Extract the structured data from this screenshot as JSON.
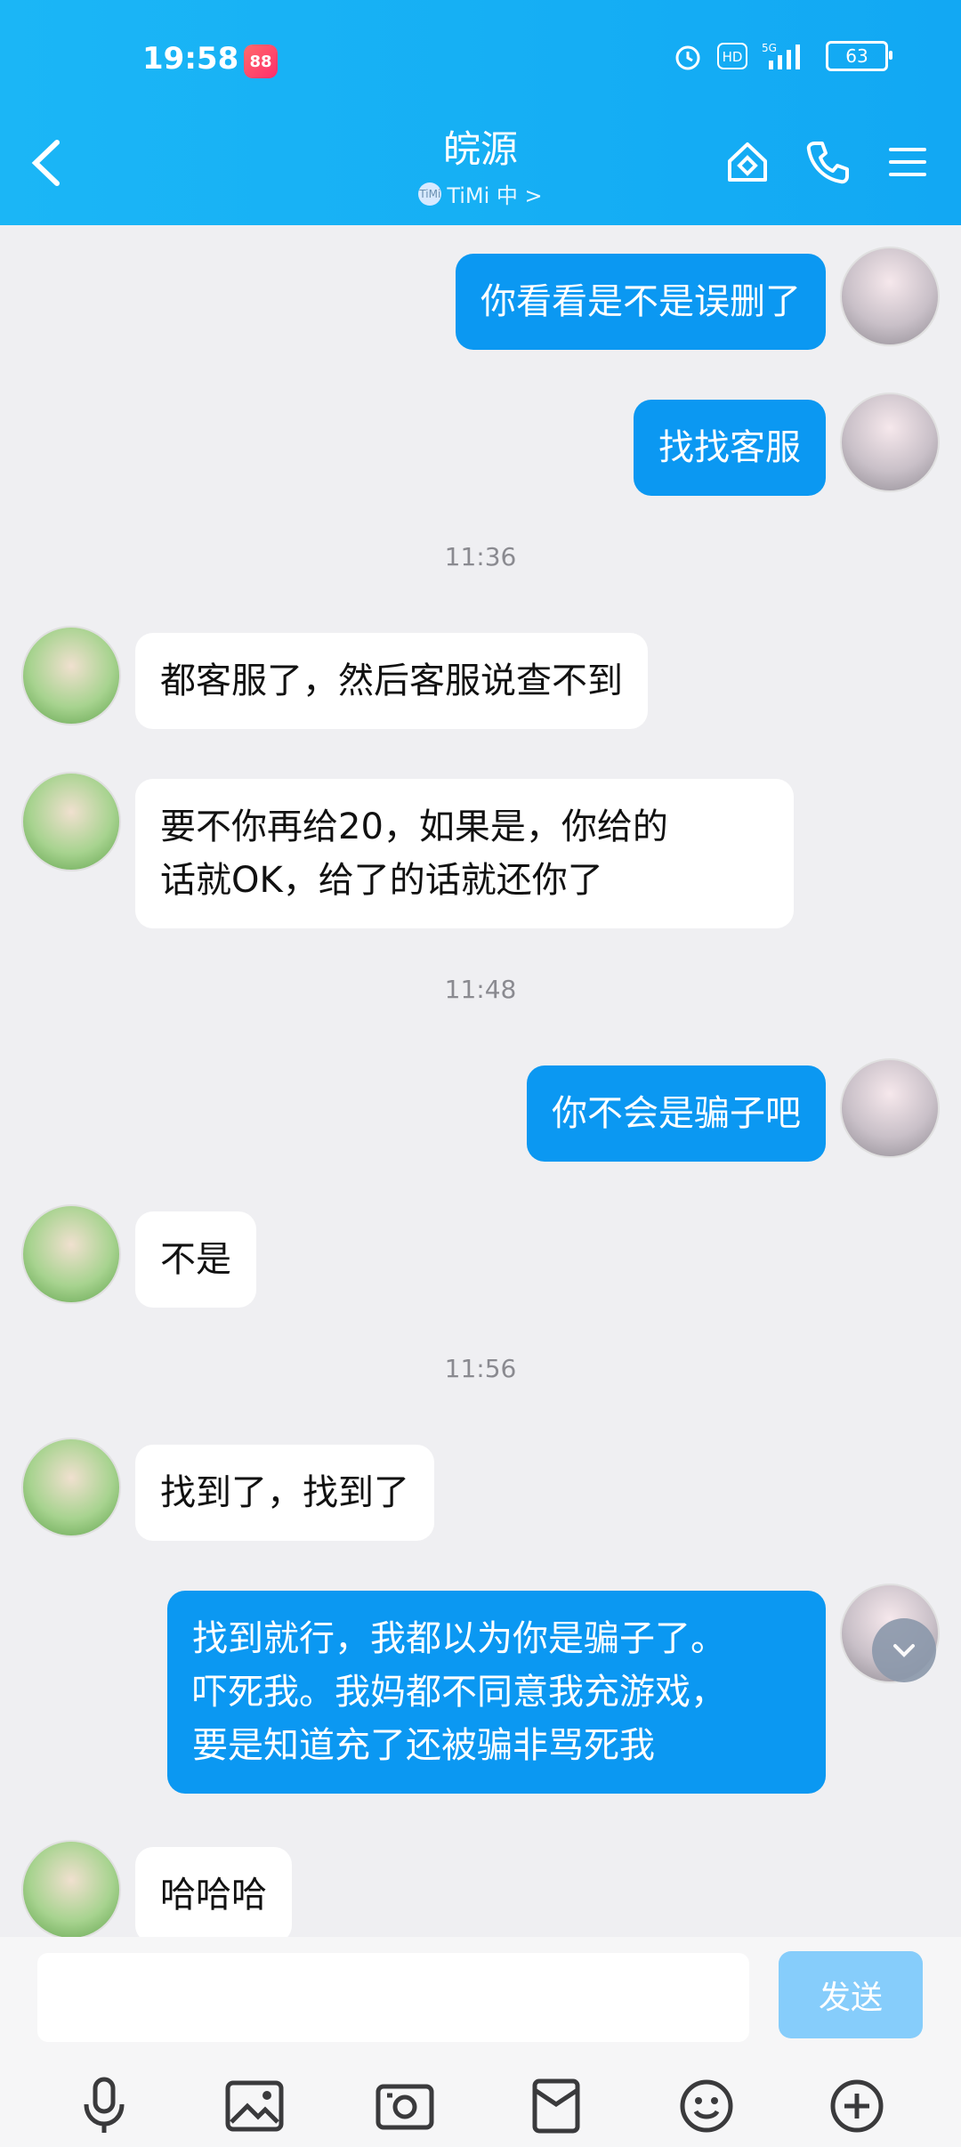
{
  "status_bar": {
    "time": "19:58",
    "app_badge": "88",
    "battery": "63",
    "network": "5G",
    "hd": "HD"
  },
  "header": {
    "title": "皖源",
    "subtitle_icon": "TiMi",
    "subtitle": "TiMi 中 >",
    "icons": [
      "home-icon",
      "phone-icon",
      "menu-icon"
    ]
  },
  "chat": {
    "messages": [
      {
        "side": "out",
        "text": "你看看是不是误删了"
      },
      {
        "side": "out",
        "text": "找找客服"
      },
      {
        "time": "11:36"
      },
      {
        "side": "in",
        "text": "都客服了，然后客服说查不到"
      },
      {
        "side": "in",
        "text": "要不你再给20，如果是，你给的\n话就OK，给了的话就还你了"
      },
      {
        "time": "11:48"
      },
      {
        "side": "out",
        "text": "你不会是骗子吧"
      },
      {
        "side": "in",
        "text": "不是"
      },
      {
        "time": "11:56"
      },
      {
        "side": "in",
        "text": "找到了，找到了"
      },
      {
        "side": "out",
        "text": "找到就行，我都以为你是骗子了。\n吓死我。我妈都不同意我充游戏，\n要是知道充了还被骗非骂死我"
      },
      {
        "side": "in",
        "text": "哈哈哈"
      }
    ]
  },
  "input": {
    "placeholder": "",
    "send_label": "发送"
  },
  "toolbar": {
    "icons": [
      "microphone-icon",
      "image-icon",
      "camera-icon",
      "red-envelope-icon",
      "emoji-icon",
      "add-icon"
    ]
  },
  "colors": {
    "header_bg": "#15aef4",
    "out_bubble": "#0b98f2",
    "in_bubble": "#ffffff",
    "send_disabled": "#86cdfb"
  }
}
